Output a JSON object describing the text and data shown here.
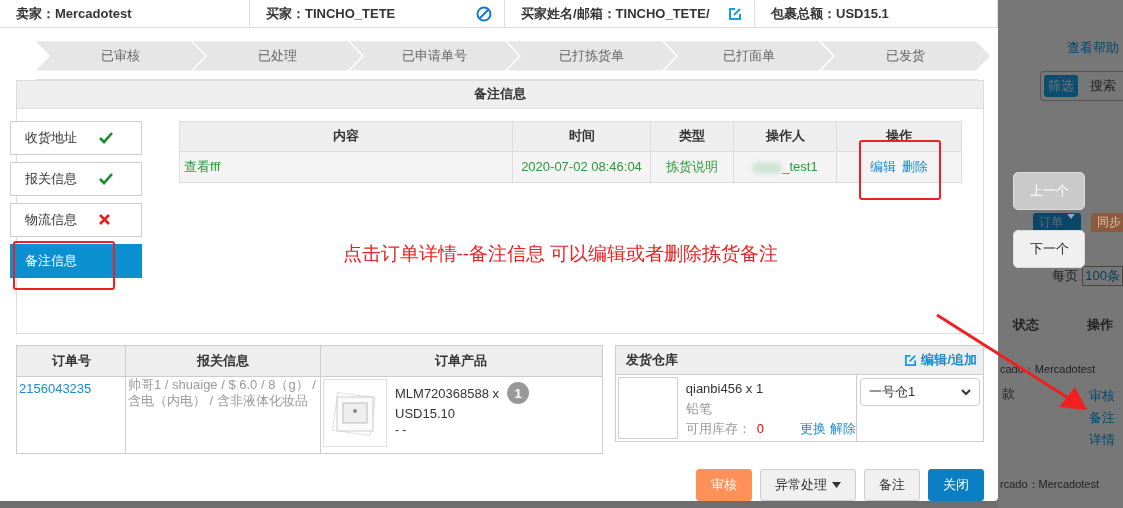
{
  "header": [
    {
      "label": "卖家：",
      "value": "Mercadotest"
    },
    {
      "label": "买家：",
      "value": "TINCHO_TETE"
    },
    {
      "label": "买家姓名/邮箱：",
      "value": "TINCHO_TETE/"
    },
    {
      "label": "包裹总额：",
      "value": "USD15.1"
    }
  ],
  "steps": [
    "已审核",
    "已处理",
    "已申请单号",
    "已打拣货单",
    "已打面单",
    "已发货"
  ],
  "remarks": {
    "title": "备注信息",
    "tabs": [
      {
        "label": "收货地址",
        "kind": "done",
        "selected": false
      },
      {
        "label": "报关信息",
        "kind": "done",
        "selected": false
      },
      {
        "label": "物流信息",
        "kind": "missing",
        "selected": false
      },
      {
        "label": "备注信息",
        "kind": "plain",
        "selected": true
      }
    ],
    "columns": [
      "内容",
      "时间",
      "类型",
      "操作人",
      "操作"
    ],
    "rows": [
      {
        "content": "查看fff",
        "time": "2020-07-02 08:46:04",
        "type": "拣货说明",
        "operator": "_test1",
        "actions": [
          "编辑",
          "删除"
        ]
      }
    ],
    "annotation": "点击订单详情--备注信息 可以编辑或者删除拣货备注"
  },
  "order_table": {
    "columns": [
      "订单号",
      "报关信息",
      "订单产品"
    ],
    "rows": [
      {
        "order_no": "2156043235",
        "customs": "帅哥1 / shuaige / $ 6.0 / 8（g） /  含电（内电） / 含非液体化妆品",
        "sku": "MLM720368588 x",
        "qty": "1",
        "price": "USD15.10",
        "note": "- -"
      }
    ]
  },
  "warehouse": {
    "title": "发货仓库",
    "action": "编辑/追加",
    "sku": "qianbi456 x 1",
    "name": "铅笔",
    "stock_label": "可用库存：",
    "stock": "0",
    "links": [
      "更换",
      "解除"
    ],
    "select": "一号仓1"
  },
  "buttons": [
    {
      "label": "审核",
      "kind": "orange"
    },
    {
      "label": "异常处理",
      "kind": "dropdown"
    },
    {
      "label": "备注",
      "kind": "default"
    },
    {
      "label": "关闭",
      "kind": "primary"
    }
  ],
  "background": {
    "help": "查看帮助",
    "toggle": [
      {
        "label": "筛选",
        "selected": true
      },
      {
        "label": "搜索",
        "selected": false
      }
    ],
    "order_button": "订单",
    "sync_button": "同步",
    "per_page": "每页",
    "page_size": "100条",
    "col_status": "状态",
    "col_ops": "操作",
    "store_1": "cado：Mercadotest",
    "cell": "款",
    "links": [
      "审核",
      "备注",
      "详情"
    ],
    "store_2": "rcado：Mercadotest"
  },
  "nav": [
    {
      "label": "上一个",
      "disabled": true
    },
    {
      "label": "下一个",
      "disabled": false
    }
  ]
}
